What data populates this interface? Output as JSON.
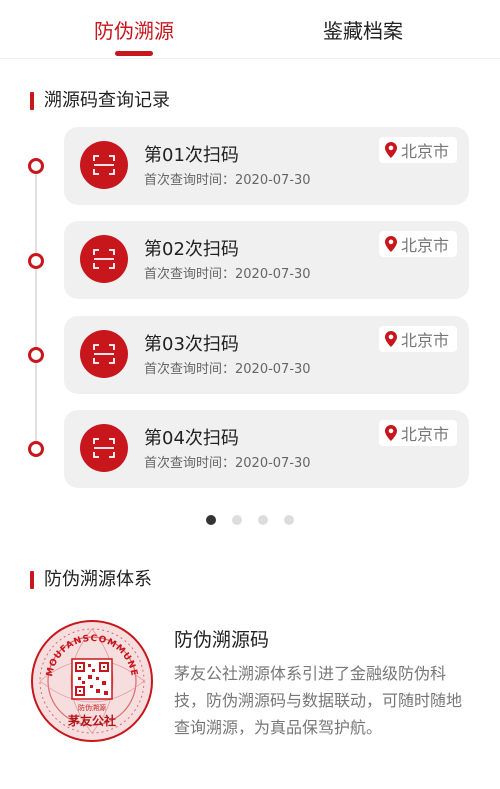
{
  "tabs": [
    {
      "label": "防伪溯源",
      "active": true
    },
    {
      "label": "鉴藏档案",
      "active": false
    }
  ],
  "records_section": {
    "title": "溯源码查询记录"
  },
  "records": [
    {
      "title": "第01次扫码",
      "subtitle": "首次查询时间：2020-07-30",
      "location": "北京市"
    },
    {
      "title": "第02次扫码",
      "subtitle": "首次查询时间：2020-07-30",
      "location": "北京市"
    },
    {
      "title": "第03次扫码",
      "subtitle": "首次查询时间：2020-07-30",
      "location": "北京市"
    },
    {
      "title": "第04次扫码",
      "subtitle": "首次查询时间：2020-07-30",
      "location": "北京市"
    }
  ],
  "pager": {
    "count": 4,
    "active_index": 0
  },
  "system_section": {
    "title": "防伪溯源体系",
    "card_title": "防伪溯源码",
    "description": "茅友公社溯源体系引进了金融级防伪科技，防伪溯源码与数据联动，可随时随地查询溯源，为真品保驾护航。",
    "seal": {
      "top_text": "MOUFANSCOMMUNE",
      "inner_label": "防伪溯源",
      "bottom_text": "茅友公社"
    }
  },
  "colors": {
    "accent": "#c8161d",
    "card_bg": "#f0f0f0",
    "muted": "#777777"
  },
  "icons": {
    "scan": "scan-frame-icon",
    "location": "map-pin-icon"
  }
}
